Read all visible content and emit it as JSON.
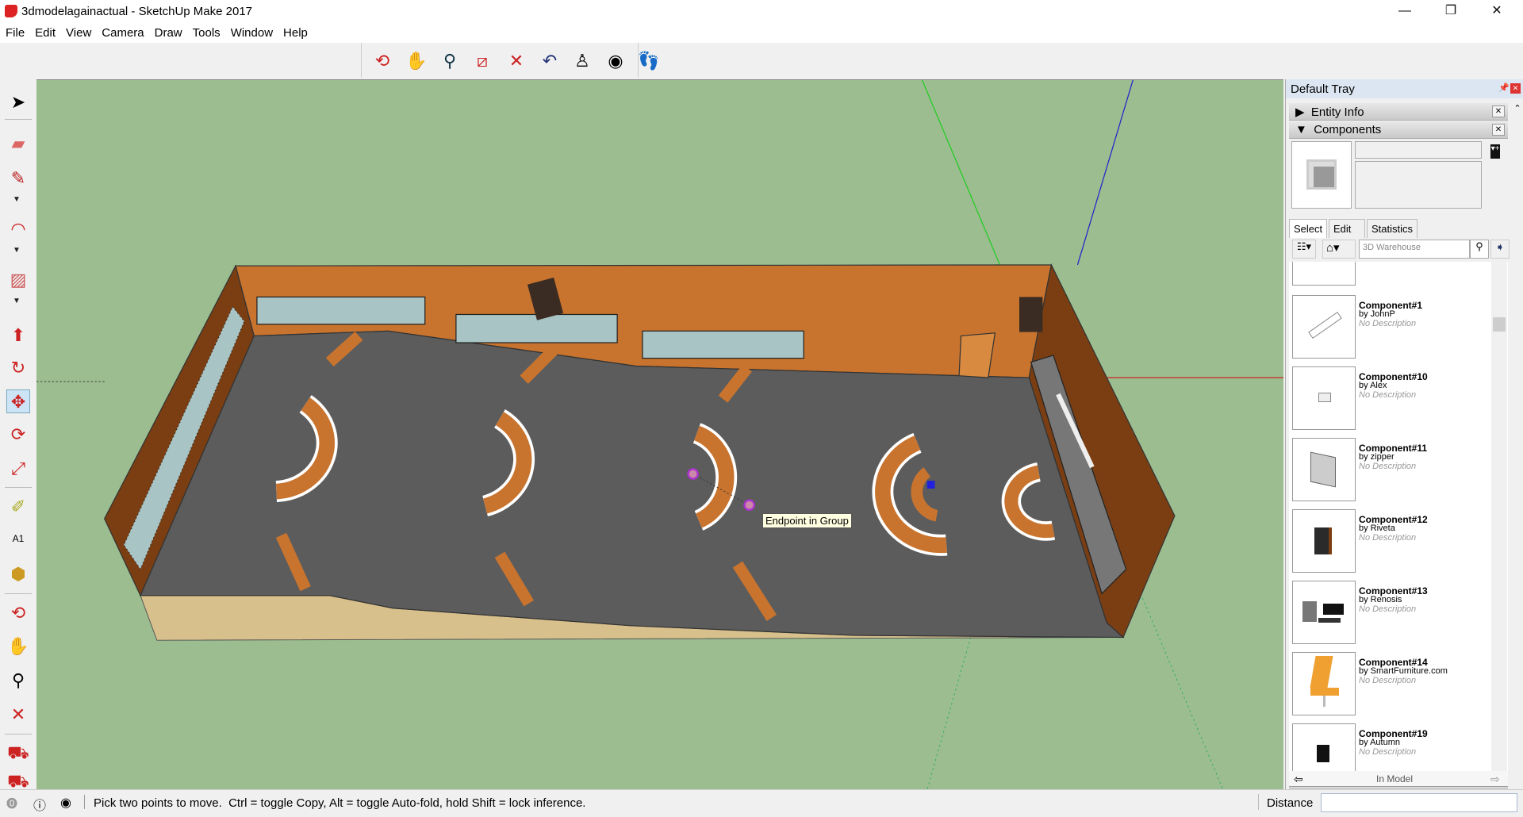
{
  "window": {
    "title": "3dmodelagainactual - SketchUp Make 2017",
    "minimize": "—",
    "restore": "❐",
    "close": "✕"
  },
  "menu": [
    "File",
    "Edit",
    "View",
    "Camera",
    "Draw",
    "Tools",
    "Window",
    "Help"
  ],
  "toolbar": [
    "orbit-icon",
    "pan-icon",
    "zoom-icon",
    "zoom-window-icon",
    "zoom-extents-icon",
    "previous-view-icon",
    "position-camera-icon",
    "look-around-icon",
    "walk-icon"
  ],
  "left_toolbar": [
    "select-icon",
    "eraser-icon",
    "pencil-icon",
    "arc-icon",
    "rectangle-icon",
    "push-pull-icon",
    "follow-me-icon",
    "move-icon",
    "rotate-icon",
    "scale-icon",
    "tape-measure-icon",
    "text-icon",
    "paint-bucket-icon",
    "orbit-icon",
    "pan-icon",
    "zoom-icon",
    "zoom-extents-icon",
    "warehouse-icon",
    "extension-warehouse-icon"
  ],
  "viewport": {
    "tooltip": "Endpoint in Group",
    "active_tool": "move"
  },
  "tray": {
    "title": "Default Tray",
    "panels": [
      {
        "label": "Entity Info",
        "expanded": false
      },
      {
        "label": "Components",
        "expanded": true
      }
    ],
    "tabs": [
      "Select",
      "Edit",
      "Statistics"
    ],
    "search_placeholder": "3D Warehouse",
    "items": [
      {
        "name": "Component#1",
        "by": "by JohnP",
        "desc": "No Description"
      },
      {
        "name": "Component#10",
        "by": "by Alex",
        "desc": "No Description"
      },
      {
        "name": "Component#11",
        "by": "by zipper",
        "desc": "No Description"
      },
      {
        "name": "Component#12",
        "by": "by Riveta",
        "desc": "No Description"
      },
      {
        "name": "Component#13",
        "by": "by Renosis",
        "desc": "No Description"
      },
      {
        "name": "Component#14",
        "by": "by SmartFurniture.com",
        "desc": "No Description"
      },
      {
        "name": "Component#19",
        "by": "by Autumn",
        "desc": "No Description"
      }
    ],
    "collection": "In Model"
  },
  "status": {
    "message": "Pick two points to move.  Ctrl = toggle Copy, Alt = toggle Auto-fold, hold Shift = lock inference.",
    "measure_label": "Distance",
    "measure_value": ""
  }
}
